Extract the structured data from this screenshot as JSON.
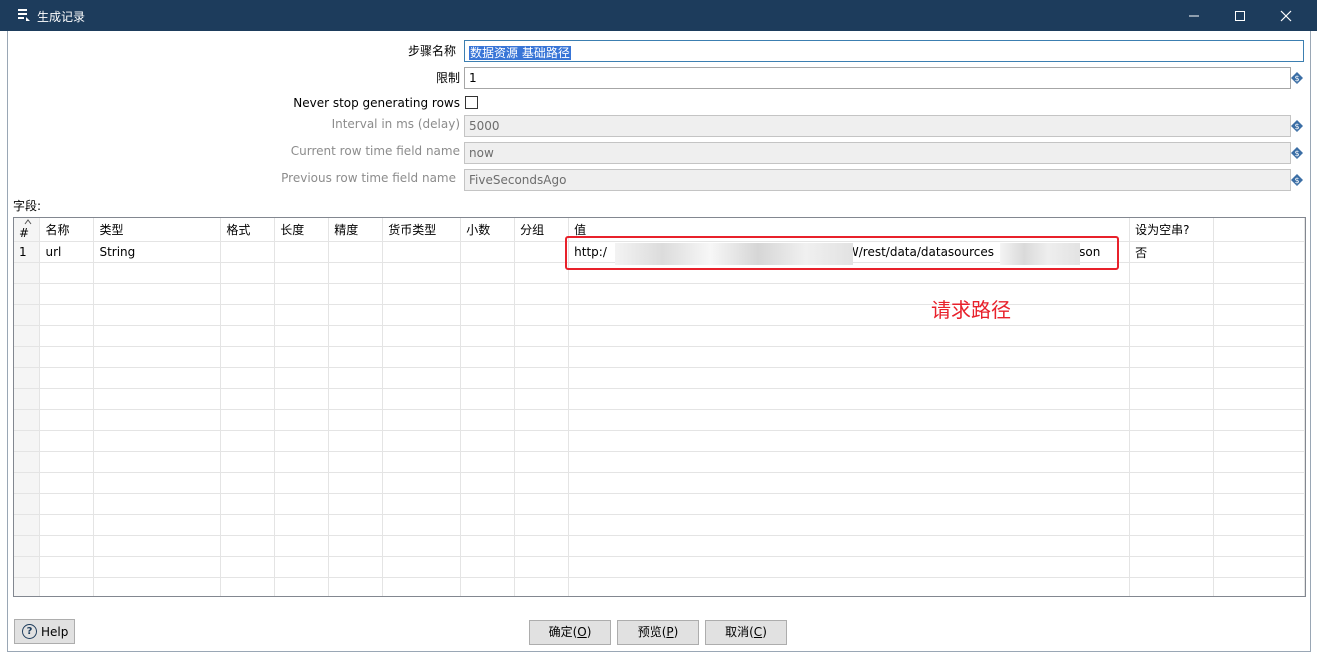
{
  "window": {
    "title": "生成记录",
    "icon": "document-list-icon",
    "controls": [
      "minimize",
      "maximize",
      "close"
    ]
  },
  "form": {
    "step_name_label": "步骤名称",
    "step_name_value": "数据资源 基础路径",
    "limit_label": "限制",
    "limit_value": "1",
    "never_stop_label": "Never stop generating rows",
    "never_stop_checked": false,
    "interval_label": "Interval in ms (delay)",
    "interval_value": "5000",
    "current_row_label": "Current row time field name",
    "current_row_value": "now",
    "previous_row_label": "Previous row time field name",
    "previous_row_value": "FiveSecondsAgo"
  },
  "fields_label": "字段:",
  "table": {
    "headers": [
      "#",
      "名称",
      "类型",
      "格式",
      "长度",
      "精度",
      "货币类型",
      "小数",
      "分组",
      "值",
      "设为空串?"
    ],
    "rows": [
      [
        "1",
        "url",
        "String",
        "",
        "",
        "",
        "",
        "",
        "",
        "",
        "否"
      ]
    ],
    "url_start": "http:/",
    "url_mid": "W/rest/data/datasources",
    "url_end": ".json"
  },
  "annotation": {
    "text": "请求路径",
    "color": "#e8212b"
  },
  "buttons": {
    "help": "Help",
    "ok_prefix": "确定(",
    "ok_key": "O",
    "preview_prefix": "预览(",
    "preview_key": "P",
    "cancel_prefix": "取消(",
    "cancel_key": "C",
    "suffix": ")"
  },
  "colors": {
    "titlebar": "#1d3c5c",
    "selection": "#3875d7",
    "accent_red": "#e8212b"
  }
}
